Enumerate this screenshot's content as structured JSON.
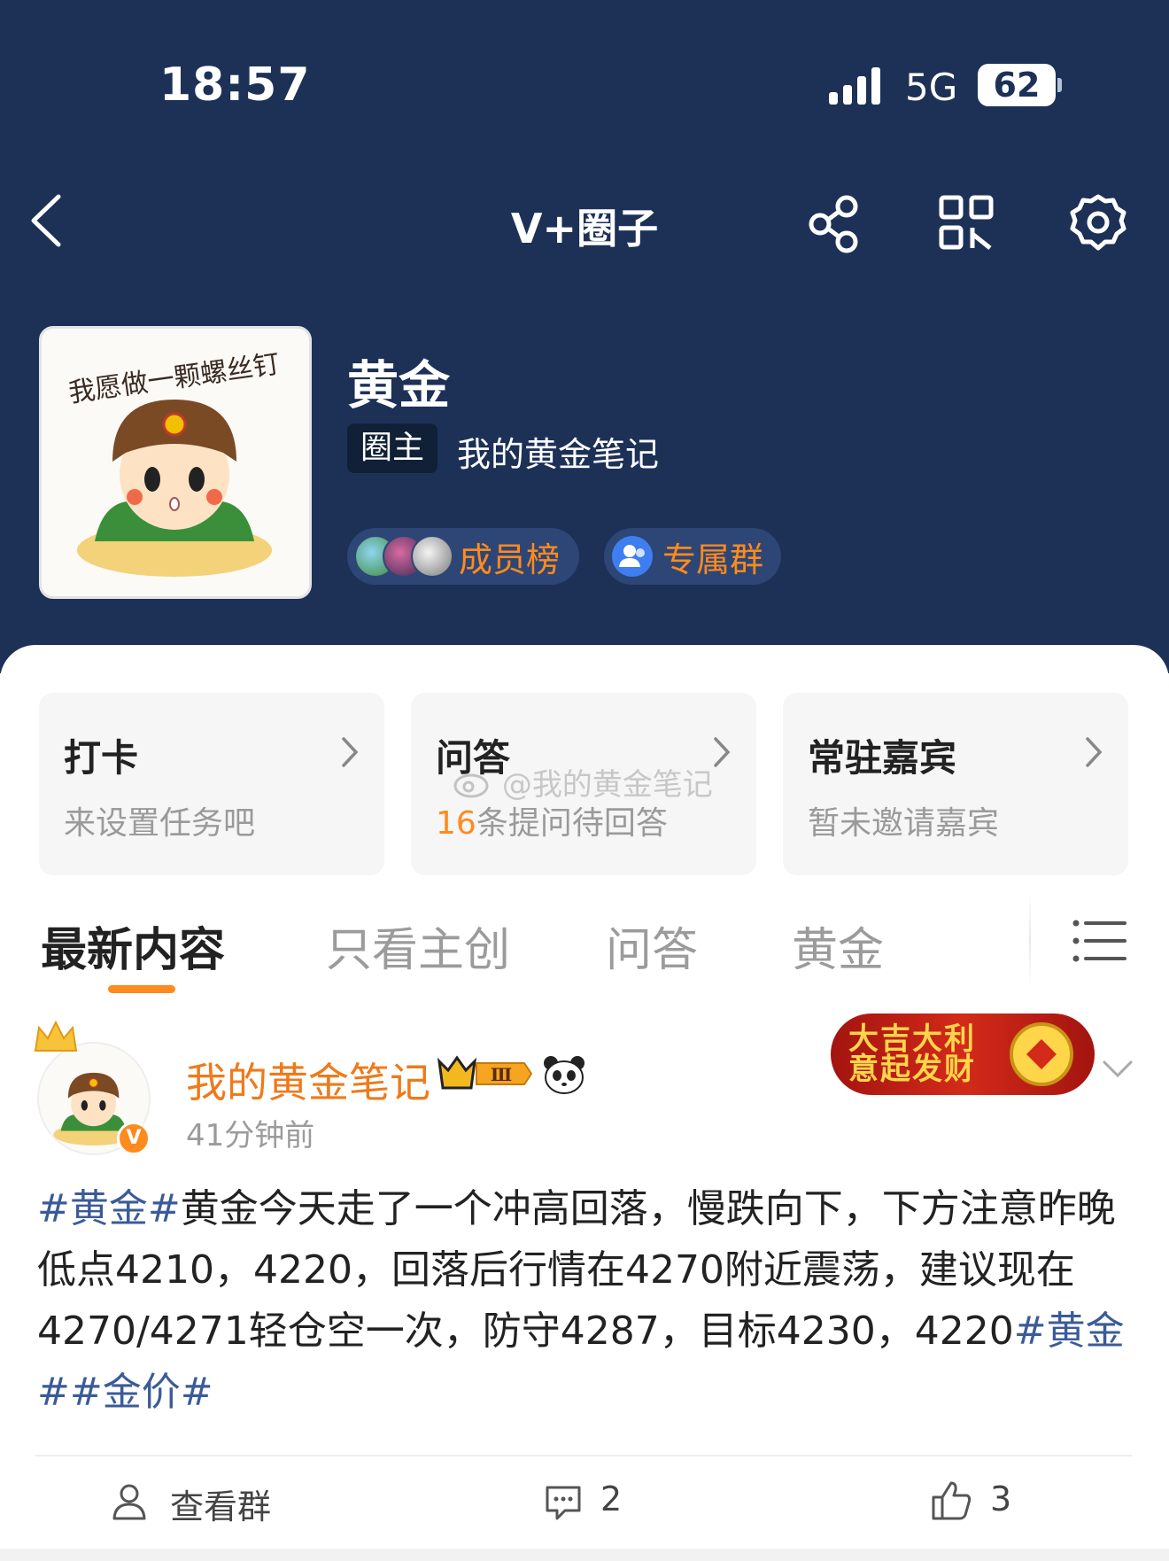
{
  "status_bar": {
    "time": "18:57",
    "network": "5G",
    "battery": "62"
  },
  "nav": {
    "title": "V+圈子",
    "icons": [
      "back-icon",
      "share-icon",
      "qr-code-icon",
      "settings-icon"
    ]
  },
  "profile": {
    "circle_name": "黄金",
    "owner_badge": "圈主",
    "owner_name": "我的黄金笔记",
    "members_label": "成员榜",
    "group_label": "专属群",
    "avatar_caption": "我愿做一颗螺丝钉"
  },
  "cards": [
    {
      "title": "打卡",
      "subtitle": "来设置任务吧"
    },
    {
      "title": "问答",
      "subtitle_count": "16",
      "subtitle": "条提问待回答"
    },
    {
      "title": "常驻嘉宾",
      "subtitle": "暂未邀请嘉宾"
    }
  ],
  "watermark": "@我的黄金笔记",
  "tabs": [
    {
      "label": "最新内容",
      "active": true
    },
    {
      "label": "只看主创",
      "active": false
    },
    {
      "label": "问答",
      "active": false
    },
    {
      "label": "黄金",
      "active": false
    }
  ],
  "post": {
    "author": "我的黄金笔记",
    "time": "41分钟前",
    "level": "Ⅲ",
    "verified": "V",
    "banner_line1": "大吉大利",
    "banner_line2": "意起发财",
    "body": {
      "tag_start": "#黄金#",
      "text": "黄金今天走了一个冲高回落，慢跌向下，下方注意昨晚低点4210，4220，回落后行情在4270附近震荡，建议现在4270/4271轻仓空一次，防守4287，目标4230，4220",
      "tag_end_1": "#黄金#",
      "tag_end_2": "#金价#"
    },
    "footer": {
      "group_label": "查看群",
      "comments": "2",
      "likes": "3"
    }
  },
  "colors": {
    "header_bg": "#1d3157",
    "accent_orange": "#ff8a1e",
    "tag_blue": "#3b5b98"
  }
}
